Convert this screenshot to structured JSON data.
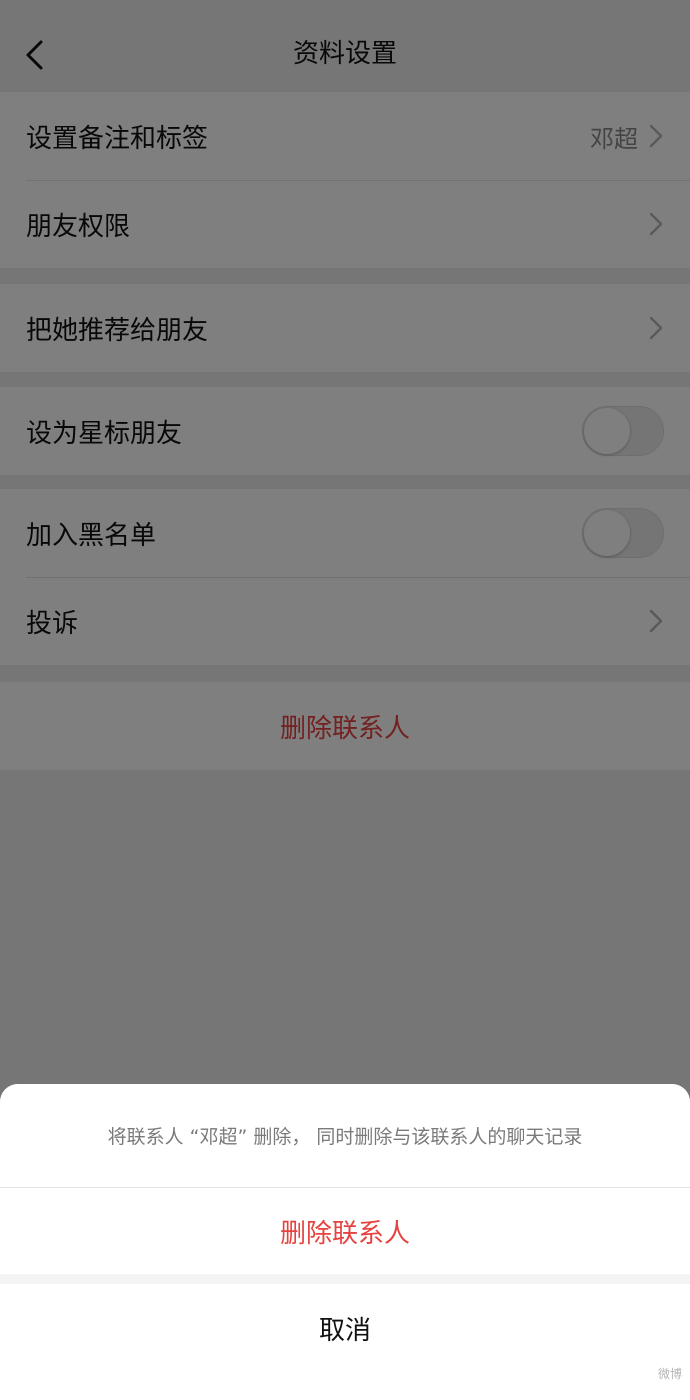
{
  "header": {
    "title": "资料设置"
  },
  "sections": {
    "remark": {
      "label": "设置备注和标签",
      "value": "邓超"
    },
    "permissions": {
      "label": "朋友权限"
    },
    "recommend": {
      "label": "把她推荐给朋友"
    },
    "star": {
      "label": "设为星标朋友",
      "on": false
    },
    "blacklist": {
      "label": "加入黑名单",
      "on": false
    },
    "report": {
      "label": "投诉"
    },
    "delete": {
      "label": "删除联系人"
    }
  },
  "sheet": {
    "message": "将联系人 “邓超” 删除， 同时删除与该联系人的聊天记录",
    "confirm_label": "删除联系人",
    "cancel_label": "取消"
  },
  "watermark": "微博",
  "colors": {
    "danger": "#e64340",
    "background": "#ededed"
  },
  "icons": {
    "back": "back-arrow-icon",
    "chevron": "chevron-right-icon"
  }
}
